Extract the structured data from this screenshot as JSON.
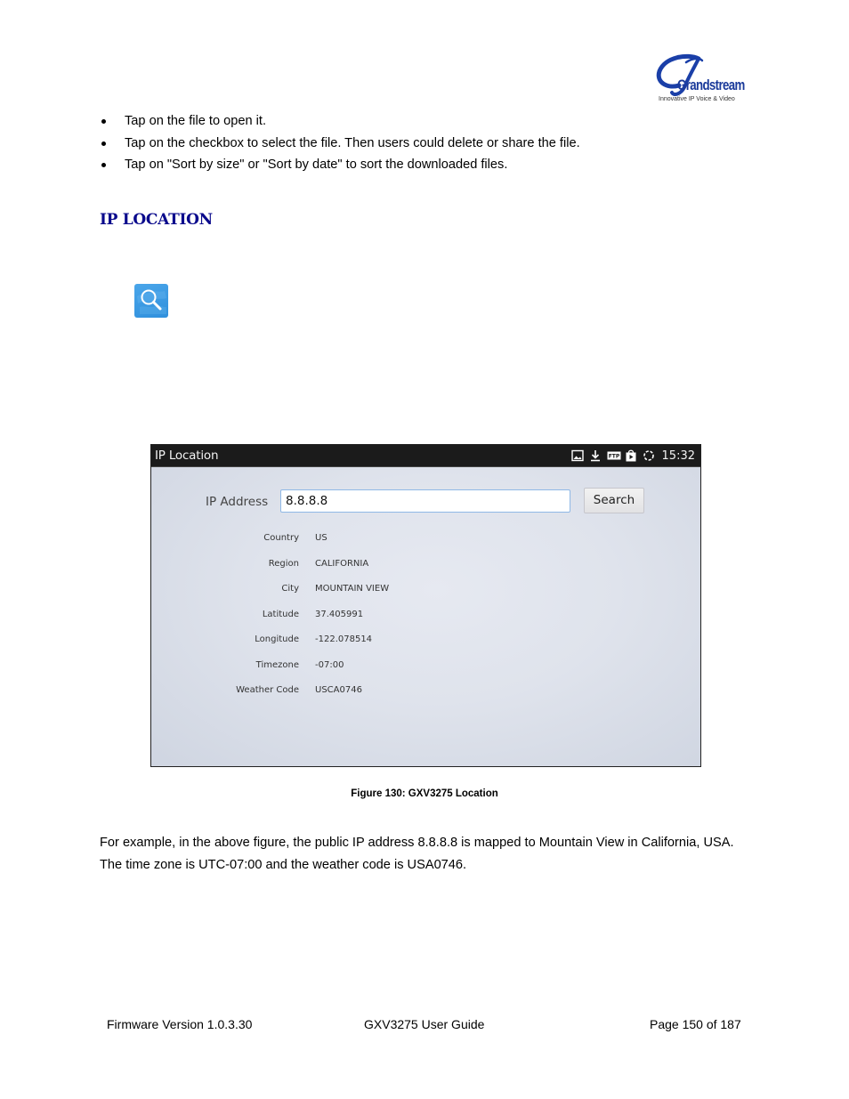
{
  "header": {
    "logo": {
      "brand": "Grandstream",
      "tagline": "Innovative IP Voice & Video"
    }
  },
  "bullets": [
    "Tap on the file to open it.",
    "Tap on the checkbox to select the file. Then users could delete or share the file.",
    "Tap on \"Sort by size\" or \"Sort by date\" to sort the downloaded files."
  ],
  "section": {
    "title": "IP LOCATION",
    "app_icon": "ip-location-search-icon"
  },
  "figure": {
    "statusbar": {
      "title": "IP Location",
      "icons": [
        "image-icon",
        "download-icon",
        "ftp-icon",
        "play-store-icon",
        "sync-icon"
      ],
      "ftp_label": "FTP",
      "time": "15:32"
    },
    "form": {
      "ip_label": "IP Address",
      "ip_value": "8.8.8.8",
      "search_label": "Search"
    },
    "results": [
      {
        "key": "Country",
        "value": "US"
      },
      {
        "key": "Region",
        "value": "CALIFORNIA"
      },
      {
        "key": "City",
        "value": "MOUNTAIN VIEW"
      },
      {
        "key": "Latitude",
        "value": "37.405991"
      },
      {
        "key": "Longitude",
        "value": "-122.078514"
      },
      {
        "key": "Timezone",
        "value": "-07:00"
      },
      {
        "key": "Weather Code",
        "value": "USCA0746"
      }
    ],
    "caption": "Figure 130: GXV3275 Location"
  },
  "paragraph": "For example, in the above figure, the public IP address 8.8.8.8 is mapped to Mountain View in California, USA. The time zone is UTC-07:00 and the weather code is USA0746.",
  "footer": {
    "firmware": "Firmware Version 1.0.3.30",
    "guide": "GXV3275 User Guide",
    "page": "Page 150 of 187"
  }
}
